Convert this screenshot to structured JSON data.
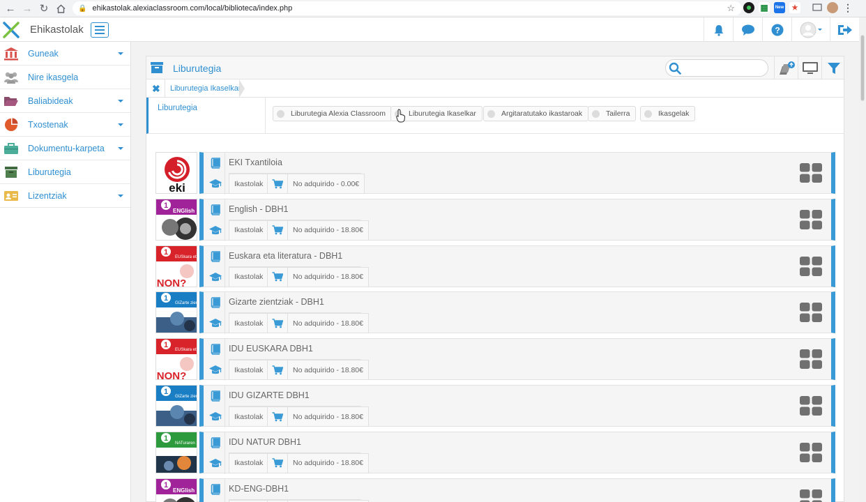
{
  "browser": {
    "url": "ehikastolak.alexiaclassroom.com/local/biblioteca/index.php",
    "ext_badge": "New"
  },
  "app": {
    "title": "Ehikastolak",
    "brand_color": "#2f8fd1",
    "accent_color": "#3a9ad6"
  },
  "sidebar": {
    "items": [
      {
        "label": "Guneak",
        "icon": "institution-icon",
        "caret": true
      },
      {
        "label": "Nire ikasgela",
        "icon": "users-icon",
        "caret": false
      },
      {
        "label": "Baliabideak",
        "icon": "folder-icon",
        "caret": true
      },
      {
        "label": "Txostenak",
        "icon": "pie-chart-icon",
        "caret": true
      },
      {
        "label": "Dokumentu-karpeta",
        "icon": "briefcase-icon",
        "caret": true
      },
      {
        "label": "Liburutegia",
        "icon": "archive-icon",
        "caret": false
      },
      {
        "label": "Lizentziak",
        "icon": "id-card-icon",
        "caret": true
      }
    ]
  },
  "panel": {
    "title": "Liburutegia",
    "search_placeholder": "",
    "breadcrumb": "Liburutegia Ikaselkar",
    "active_tab": "Liburutegia",
    "filters": [
      "Liburutegia Alexia Classroom",
      "Liburutegia Ikaselkar",
      "Argitaratutako ikastaroak",
      "Tailerra",
      "Ikasgelak"
    ]
  },
  "books": [
    {
      "title": "EKI Txantiloia",
      "school": "Ikastolak",
      "price": "No adquirido - 0.00€",
      "cover": "eki"
    },
    {
      "title": "English - DBH1",
      "school": "Ikastolak",
      "price": "No adquirido - 18.80€",
      "cover": "english"
    },
    {
      "title": "Euskara eta literatura - DBH1",
      "school": "Ikastolak",
      "price": "No adquirido - 18.80€",
      "cover": "euskara"
    },
    {
      "title": "Gizarte zientziak - DBH1",
      "school": "Ikastolak",
      "price": "No adquirido - 18.80€",
      "cover": "gizarte"
    },
    {
      "title": "IDU EUSKARA DBH1",
      "school": "Ikastolak",
      "price": "No adquirido - 18.80€",
      "cover": "euskara"
    },
    {
      "title": "IDU GIZARTE DBH1",
      "school": "Ikastolak",
      "price": "No adquirido - 18.80€",
      "cover": "gizarte"
    },
    {
      "title": "IDU NATUR DBH1",
      "school": "Ikastolak",
      "price": "No adquirido - 18.80€",
      "cover": "natur"
    },
    {
      "title": "KD-ENG-DBH1",
      "school": "",
      "price": "",
      "cover": "english"
    }
  ],
  "covers": {
    "eki_text": "eki",
    "english_text": "ENGlish",
    "english_num": "1",
    "euskara_text": "EUSkara eta literatura",
    "euskara_big": "NON?",
    "gizarte_text": "GIZarte zientziak",
    "natur_text": "NATuraren zientziak"
  }
}
